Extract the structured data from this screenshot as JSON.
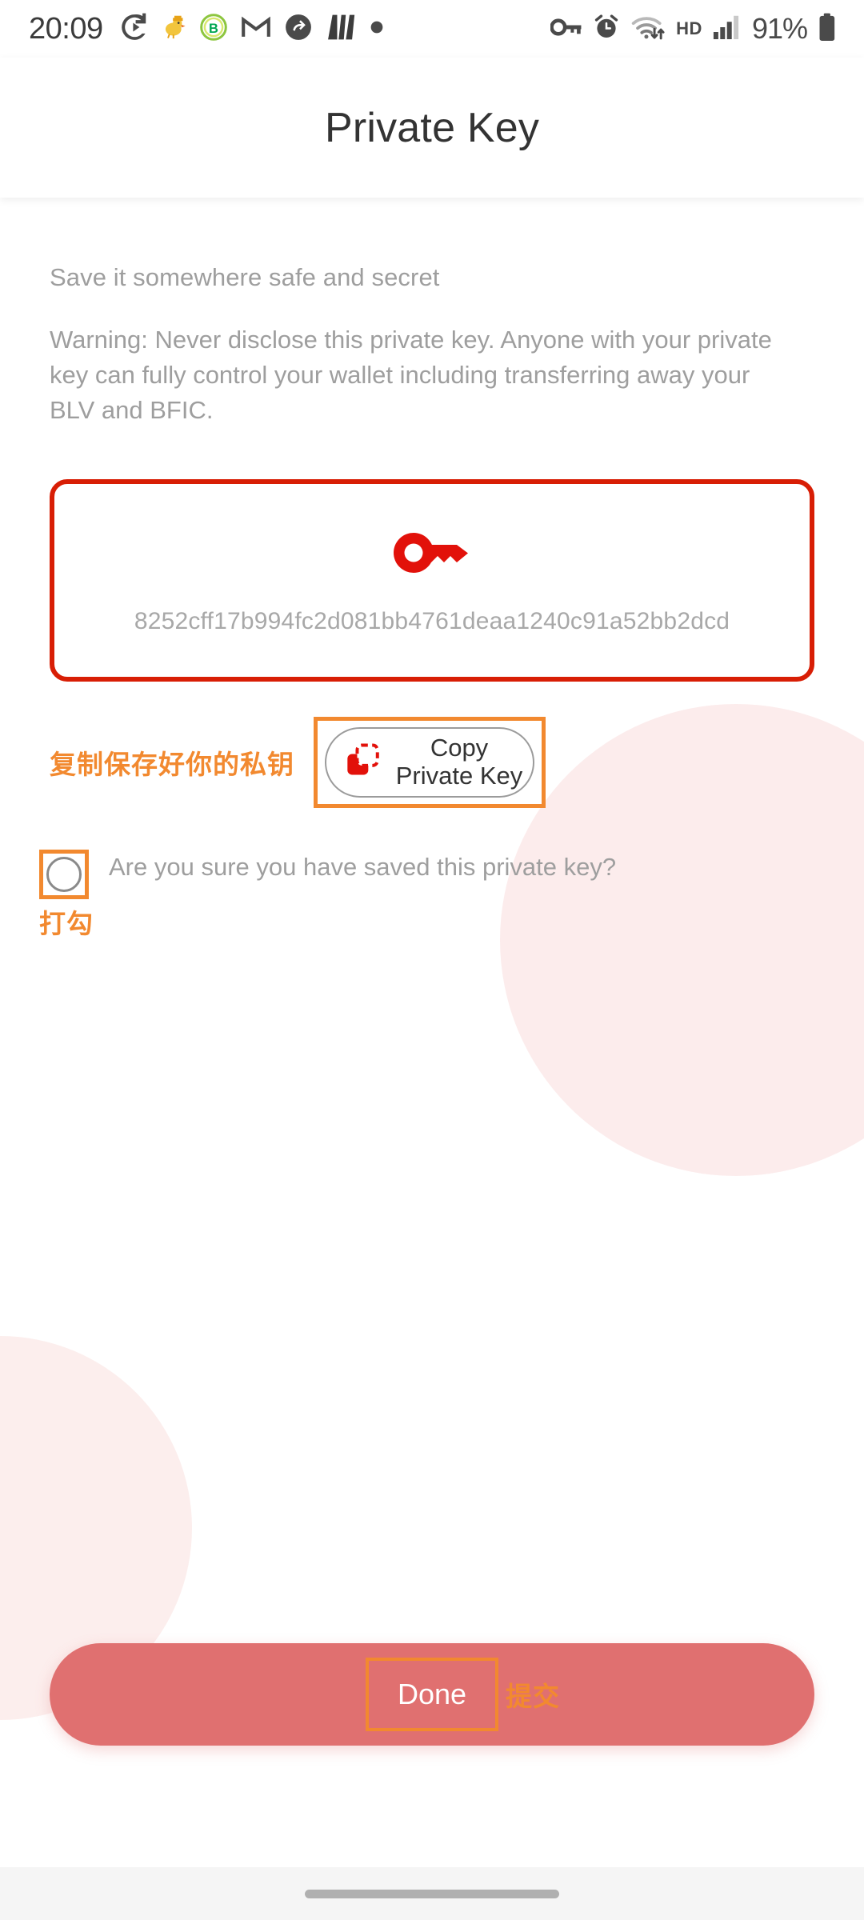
{
  "status_bar": {
    "clock": "20:09",
    "battery_percent": "91%",
    "hd_label": "HD",
    "left_icons": [
      {
        "name": "go-arrow-icon"
      },
      {
        "name": "duck-app-icon"
      },
      {
        "name": "green-badge-icon"
      },
      {
        "name": "gmail-icon"
      },
      {
        "name": "sync-icon"
      },
      {
        "name": "mw-app-icon"
      },
      {
        "name": "dot-icon"
      }
    ],
    "right_icons": [
      {
        "name": "vpn-key-icon"
      },
      {
        "name": "alarm-icon"
      },
      {
        "name": "wifi-icon"
      },
      {
        "name": "signal-bars-icon"
      },
      {
        "name": "battery-icon"
      }
    ]
  },
  "header": {
    "title": "Private Key"
  },
  "main": {
    "subtitle": "Save it somewhere safe and secret",
    "warning": "Warning: Never disclose this private key. Anyone with your private key can fully control your wallet including transferring away your BLV and BFIC.",
    "key_card": {
      "icon": "key-icon",
      "private_key": "8252cff17b994fc2d081bb4761deaa1240c91a52bb2dcd",
      "border_color": "#d81e05"
    },
    "copy": {
      "annotation_label": "复制保存好你的私钥",
      "button_label": "Copy Private Key",
      "icon": "copy-icon"
    },
    "confirm": {
      "annotation_label": "打勾",
      "text": "Are you sure you have saved this private key?",
      "checked": false
    }
  },
  "footer": {
    "done_label": "Done",
    "done_annotation_label": "提交"
  },
  "colors": {
    "accent_red": "#d81e05",
    "annotation_orange": "#f2892f",
    "done_button": "#e07070",
    "muted_text": "#9e9e9e"
  }
}
